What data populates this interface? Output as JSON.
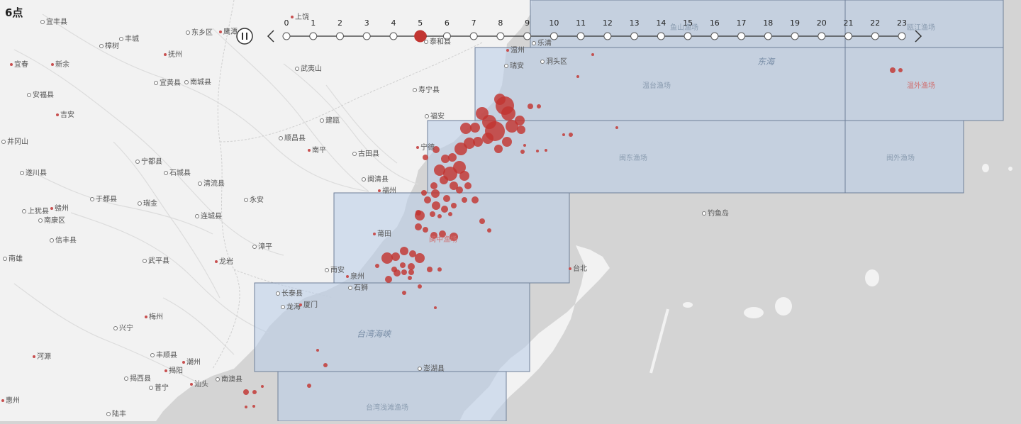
{
  "title": "6点",
  "timeline": {
    "hours": [
      "0",
      "1",
      "2",
      "3",
      "4",
      "5",
      "6",
      "7",
      "8",
      "9",
      "10",
      "11",
      "12",
      "13",
      "14",
      "15",
      "16",
      "17",
      "18",
      "19",
      "20",
      "21",
      "22",
      "23"
    ],
    "current_index": 5,
    "pause_icon": "pause-icon",
    "prev_icon": "chevron-left-icon",
    "next_icon": "chevron-right-icon"
  },
  "map": {
    "cities": [
      {
        "name": "上饶",
        "dot": "red"
      },
      {
        "name": "宜丰县",
        "dot": "ring"
      },
      {
        "name": "东乡区",
        "dot": "ring"
      },
      {
        "name": "鹰潭",
        "dot": "red"
      },
      {
        "name": "丰城",
        "dot": "ring"
      },
      {
        "name": "樟树",
        "dot": "ring"
      },
      {
        "name": "抚州",
        "dot": "red"
      },
      {
        "name": "宜春",
        "dot": "red"
      },
      {
        "name": "新余",
        "dot": "red"
      },
      {
        "name": "南城县",
        "dot": "ring"
      },
      {
        "name": "宜黄县",
        "dot": "ring"
      },
      {
        "name": "武夷山",
        "dot": "ring"
      },
      {
        "name": "寿宁县",
        "dot": "ring"
      },
      {
        "name": "安福县",
        "dot": "ring"
      },
      {
        "name": "吉安",
        "dot": "red"
      },
      {
        "name": "福安",
        "dot": "ring"
      },
      {
        "name": "建瓯",
        "dot": "ring"
      },
      {
        "name": "井冈山",
        "dot": "ring"
      },
      {
        "name": "顺昌县",
        "dot": "ring"
      },
      {
        "name": "南平",
        "dot": "red"
      },
      {
        "name": "古田县",
        "dot": "ring"
      },
      {
        "name": "宁德",
        "dot": "red"
      },
      {
        "name": "宁都县",
        "dot": "ring"
      },
      {
        "name": "石城县",
        "dot": "ring"
      },
      {
        "name": "遂川县",
        "dot": "ring"
      },
      {
        "name": "闽清县",
        "dot": "ring"
      },
      {
        "name": "清流县",
        "dot": "ring"
      },
      {
        "name": "福州",
        "dot": "red"
      },
      {
        "name": "于都县",
        "dot": "ring"
      },
      {
        "name": "瑞金",
        "dot": "ring"
      },
      {
        "name": "永安",
        "dot": "ring"
      },
      {
        "name": "上犹县",
        "dot": "ring"
      },
      {
        "name": "赣州",
        "dot": "red"
      },
      {
        "name": "南康区",
        "dot": "ring"
      },
      {
        "name": "连城县",
        "dot": "ring"
      },
      {
        "name": "莆田",
        "dot": "red"
      },
      {
        "name": "信丰县",
        "dot": "ring"
      },
      {
        "name": "漳平",
        "dot": "ring"
      },
      {
        "name": "南雄",
        "dot": "ring"
      },
      {
        "name": "武平县",
        "dot": "ring"
      },
      {
        "name": "龙岩",
        "dot": "red"
      },
      {
        "name": "南安",
        "dot": "ring"
      },
      {
        "name": "泉州",
        "dot": "red"
      },
      {
        "name": "石狮",
        "dot": "ring"
      },
      {
        "name": "长泰县",
        "dot": "ring"
      },
      {
        "name": "龙海",
        "dot": "ring"
      },
      {
        "name": "厦门",
        "dot": "red"
      },
      {
        "name": "梅州",
        "dot": "red"
      },
      {
        "name": "兴宁",
        "dot": "ring"
      },
      {
        "name": "河源",
        "dot": "red"
      },
      {
        "name": "丰顺县",
        "dot": "ring"
      },
      {
        "name": "潮州",
        "dot": "red"
      },
      {
        "name": "揭阳",
        "dot": "red"
      },
      {
        "name": "揭西县",
        "dot": "ring"
      },
      {
        "name": "南澳县",
        "dot": "ring"
      },
      {
        "name": "汕头",
        "dot": "red"
      },
      {
        "name": "普宁",
        "dot": "ring"
      },
      {
        "name": "惠州",
        "dot": "red"
      },
      {
        "name": "陆丰",
        "dot": "ring"
      },
      {
        "name": "温州",
        "dot": "red"
      },
      {
        "name": "瑞安",
        "dot": "ring"
      },
      {
        "name": "洞头区",
        "dot": "ring"
      },
      {
        "name": "台北",
        "dot": "red"
      },
      {
        "name": "澎湖县",
        "dot": "ring"
      },
      {
        "name": "钓鱼岛",
        "dot": "ring"
      },
      {
        "name": "泰和县",
        "dot": "ring"
      },
      {
        "name": "乐清",
        "dot": "ring"
      }
    ],
    "sea_labels": [
      "东海",
      "台湾海峡"
    ],
    "zone_labels": [
      "温台渔场",
      "闽东渔场",
      "闽中渔场",
      "台湾浅滩渔场",
      "温外渔场",
      "闽外渔场",
      "鱼山渔场",
      "瓯江渔场"
    ],
    "colors": {
      "land": "#f2f2f2",
      "sea": "#d4d4d4",
      "grid": "#b8cce8",
      "bubble": "#c23531",
      "timeline_active": "#c23531"
    }
  }
}
